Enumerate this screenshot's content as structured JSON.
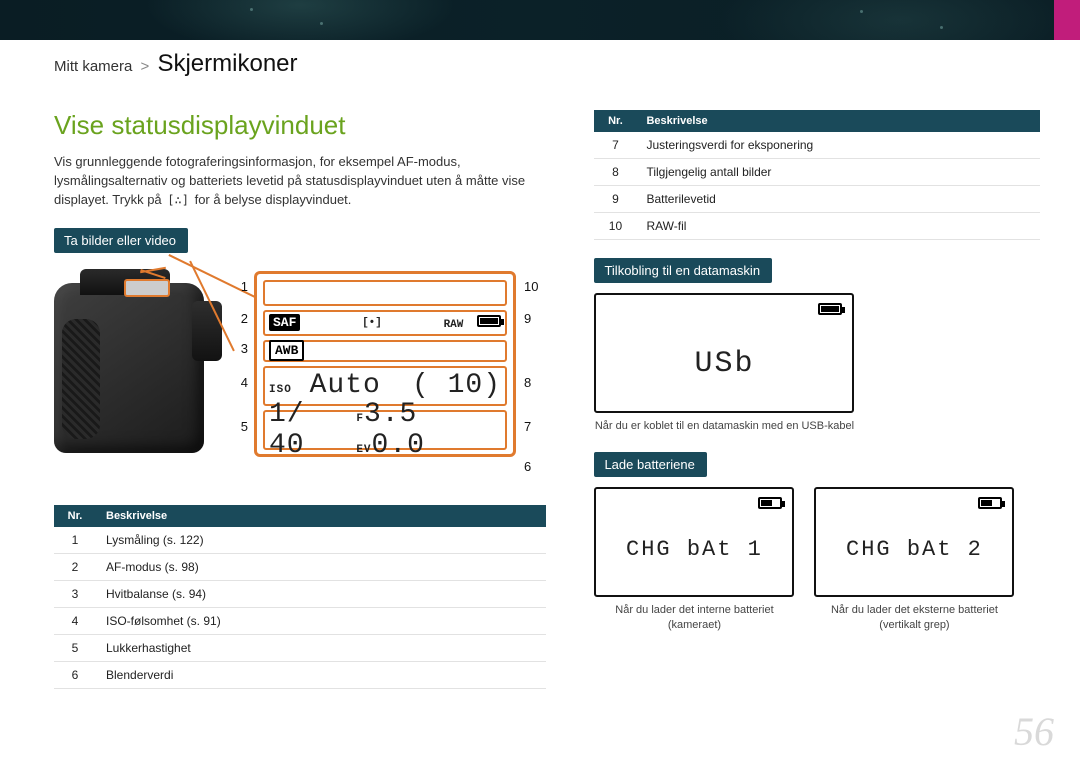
{
  "breadcrumb": {
    "section": "Mitt kamera",
    "page": "Skjermikoner"
  },
  "title": "Vise statusdisplayvinduet",
  "intro_a": "Vis grunnleggende fotograferingsinformasjon, for eksempel AF-modus, lysmålingsalternativ og batteriets levetid på statusdisplayvinduet uten å måtte vise displayet. Trykk på ",
  "intro_glyph": "[∴]",
  "intro_b": " for å belyse displayvinduet.",
  "sub1": "Ta bilder eller video",
  "sub2": "Tilkobling til en datamaskin",
  "sub3": "Lade batteriene",
  "lcd": {
    "row2_left": "SAF",
    "row2_mid": "[•]",
    "row2_raw": "RAW",
    "row3": "AWB",
    "row4_iso": "ISO",
    "row4_auto": "Auto",
    "row4_brkt": "(   10)",
    "row5_shutter": "1/  40",
    "row5_f": "F",
    "row5_fval": "3.5",
    "row5_ev": "EV",
    "row5_evval": "0.0"
  },
  "labels_left": [
    "1",
    "2",
    "3",
    "4",
    "5"
  ],
  "labels_right": [
    "10",
    "9",
    "8",
    "7",
    "6"
  ],
  "table_hdr": {
    "nr": "Nr.",
    "desc": "Beskrivelse"
  },
  "table1": [
    {
      "n": "1",
      "d": "Lysmåling (s. 122)"
    },
    {
      "n": "2",
      "d": "AF-modus (s. 98)"
    },
    {
      "n": "3",
      "d": "Hvitbalanse (s. 94)"
    },
    {
      "n": "4",
      "d": "ISO-følsomhet (s. 91)"
    },
    {
      "n": "5",
      "d": "Lukkerhastighet"
    },
    {
      "n": "6",
      "d": "Blenderverdi"
    }
  ],
  "table2": [
    {
      "n": "7",
      "d": "Justeringsverdi for eksponering"
    },
    {
      "n": "8",
      "d": "Tilgjengelig antall bilder"
    },
    {
      "n": "9",
      "d": "Batterilevetid"
    },
    {
      "n": "10",
      "d": "RAW-fil"
    }
  ],
  "usb_text": "USb",
  "usb_caption": "Når du er koblet til en datamaskin med en USB-kabel",
  "chg1_text": "CHG bAt 1",
  "chg1_caption": "Når du lader det interne batteriet (kameraet)",
  "chg2_text": "CHG bAt 2",
  "chg2_caption": "Når du lader det eksterne batteriet (vertikalt grep)",
  "page_number": "56"
}
